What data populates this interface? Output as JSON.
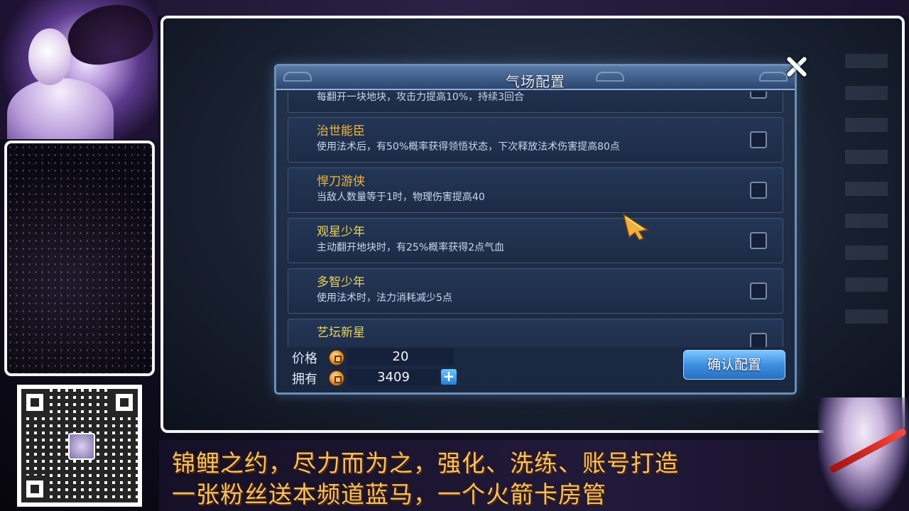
{
  "dialog": {
    "title": "气场配置",
    "items": [
      {
        "name": "",
        "desc": "每翻开一块地块，攻击力提高10%，持续3回合",
        "checked": true
      },
      {
        "name": "治世能臣",
        "desc": "使用法术后，有50%概率获得领悟状态，下次释放法术伤害提高80点",
        "checked": false
      },
      {
        "name": "悍刀游侠",
        "desc": "当敌人数量等于1时，物理伤害提高40",
        "checked": false
      },
      {
        "name": "观星少年",
        "desc": "主动翻开地块时，有25%概率获得2点气血",
        "checked": false
      },
      {
        "name": "多智少年",
        "desc": "使用法术时，法力消耗减少5点",
        "checked": false
      },
      {
        "name": "艺坛新星",
        "desc": "",
        "checked": false
      }
    ],
    "price_label": "价格",
    "price_value": "20",
    "owned_label": "拥有",
    "owned_value": "3409",
    "add_symbol": "+",
    "confirm_label": "确认配置",
    "scroll_symbol": "⌄",
    "checkmark_symbol": "✔"
  },
  "banner": {
    "line1": "锦鲤之约，尽力而为之，强化、洗练、账号打造",
    "line2": "一张粉丝送本频道蓝马，一个火箭卡房管"
  },
  "icons": {
    "close": "close-icon",
    "coin": "coin-icon",
    "cursor": "arrow-cursor-icon"
  },
  "colors": {
    "item_name_orange": "#f0b43a",
    "item_name_gold": "#e9d25a",
    "confirm_button": "#3d8fe0",
    "banner_text": "#f1c16a",
    "check_green": "#59d63a"
  }
}
